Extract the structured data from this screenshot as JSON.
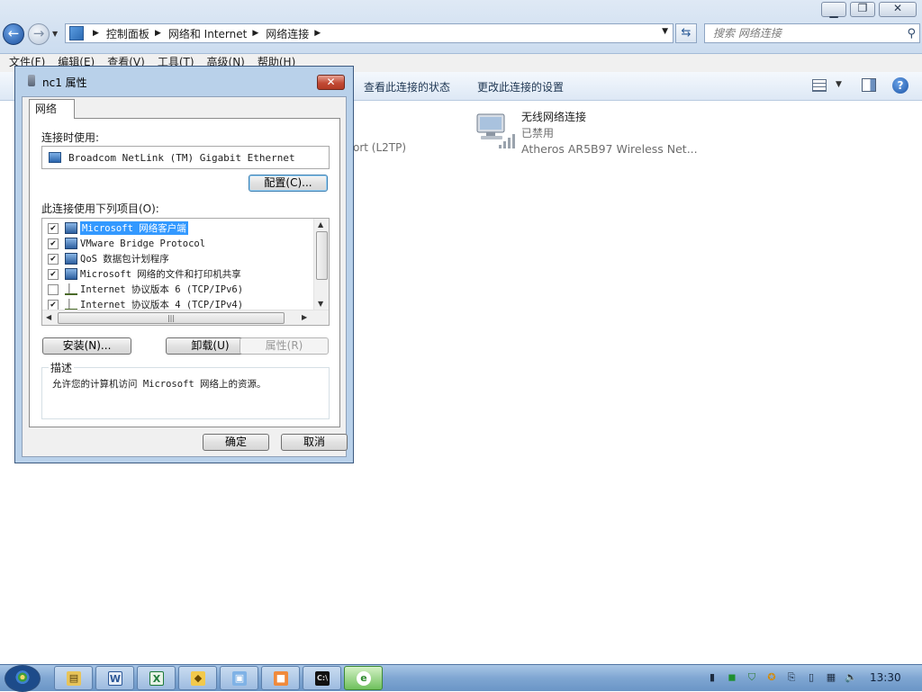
{
  "window": {
    "address": {
      "crumbs": [
        "控制面板",
        "网络和 Internet",
        "网络连接"
      ]
    },
    "search_placeholder": "搜索 网络连接",
    "menu": [
      "文件(F)",
      "编辑(E)",
      "查看(V)",
      "工具(T)",
      "高级(N)",
      "帮助(H)"
    ],
    "commands": {
      "view_status": "查看此连接的状态",
      "change_settings": "更改此连接的设置"
    }
  },
  "content": {
    "partial_text": "ort (L2TP)",
    "wireless": {
      "name": "无线网络连接",
      "status": "已禁用",
      "device": "Atheros AR5B97 Wireless Net..."
    }
  },
  "dialog": {
    "title": "nc1 属性",
    "tab": "网络",
    "connect_using_label": "连接时使用:",
    "adapter": "Broadcom NetLink (TM) Gigabit Ethernet",
    "configure_button": "配置(C)...",
    "items_label": "此连接使用下列项目(O):",
    "items": [
      {
        "label": "Microsoft 网络客户端",
        "checked": true,
        "icon": "network-client-icon",
        "selected": true
      },
      {
        "label": "VMware Bridge Protocol",
        "checked": true,
        "icon": "network-service-icon",
        "selected": false
      },
      {
        "label": "QoS 数据包计划程序",
        "checked": true,
        "icon": "network-service-icon",
        "selected": false
      },
      {
        "label": "Microsoft 网络的文件和打印机共享",
        "checked": true,
        "icon": "network-service-icon",
        "selected": false
      },
      {
        "label": "Internet 协议版本 6 (TCP/IPv6)",
        "checked": false,
        "icon": "protocol-icon",
        "selected": false
      },
      {
        "label": "Internet 协议版本 4 (TCP/IPv4)",
        "checked": true,
        "icon": "protocol-icon",
        "selected": false
      }
    ],
    "install_button": "安装(N)...",
    "uninstall_button": "卸载(U)",
    "properties_button": "属性(R)",
    "description_label": "描述",
    "description": "允许您的计算机访问 Microsoft 网络上的资源。",
    "ok_button": "确定",
    "cancel_button": "取消",
    "close_glyph": "✕"
  },
  "taskbar": {
    "clock": "13:30"
  }
}
